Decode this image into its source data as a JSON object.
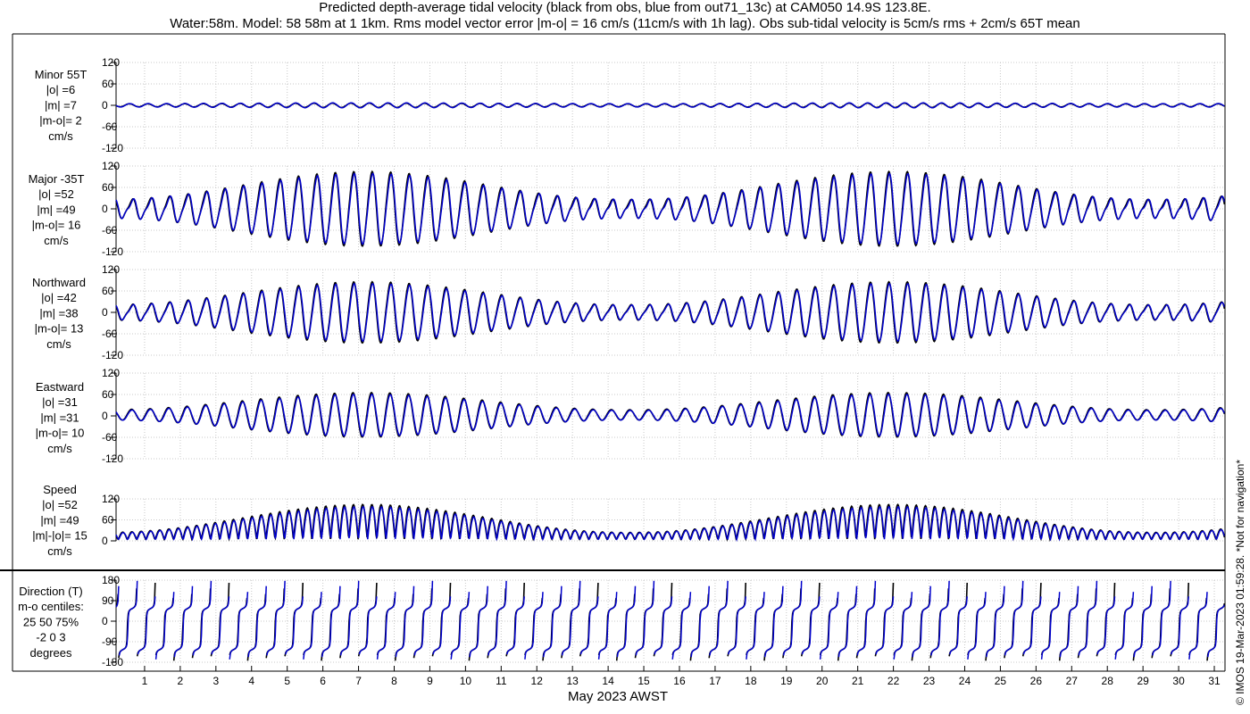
{
  "title_line1": "Predicted depth-average tidal velocity (black from obs, blue from out71_13c) at CAM050 14.9S 123.8E.",
  "title_line2": "Water:58m. Model: 58 58m at 1 1km. Rms model vector error |m-o| = 16 cm/s (11cm/s with 1h lag). Obs sub-tidal velocity is 5cm/s rms + 2cm/s 65T mean",
  "credit": "© IMOS 19-Mar-2023 01:59:28. *Not for navigation*",
  "xlabel": "May 2023 AWST",
  "colors": {
    "obs": "#000000",
    "model": "#0000cc",
    "grid": "#c8c8c8",
    "axis": "#000000"
  },
  "chart_data": {
    "type": "line",
    "x_axis": {
      "label": "May 2023 AWST",
      "unit": "day of May 2023",
      "range": [
        0.2,
        31.3
      ],
      "ticks": [
        1,
        2,
        3,
        4,
        5,
        6,
        7,
        8,
        9,
        10,
        11,
        12,
        13,
        14,
        15,
        16,
        17,
        18,
        19,
        20,
        21,
        22,
        23,
        24,
        25,
        26,
        27,
        28,
        29,
        30,
        31
      ]
    },
    "series_legend": {
      "obs": "black from obs",
      "model": "blue from out71_13c"
    },
    "panels": [
      {
        "key": "minor",
        "label_lines": [
          "Minor 55T",
          "|o| =6",
          "|m| =7",
          "|m-o|= 2",
          "cm/s"
        ],
        "ylim": [
          -120,
          120
        ],
        "yticks": [
          -120,
          -60,
          0,
          60,
          120
        ],
        "tick_labels": [
          "-120",
          "-60",
          "0",
          "60",
          "120"
        ],
        "obs_amplitude": 6,
        "model_amplitude": 7,
        "rms_diff": 2
      },
      {
        "key": "major",
        "label_lines": [
          "Major -35T",
          "|o| =52",
          "|m| =49",
          "|m-o|= 16",
          "cm/s"
        ],
        "ylim": [
          -120,
          120
        ],
        "yticks": [
          -120,
          -60,
          0,
          60,
          120
        ],
        "tick_labels": [
          "-120",
          "-60",
          "0",
          "60",
          "120"
        ],
        "obs_amplitude": 52,
        "model_amplitude": 49,
        "rms_diff": 16
      },
      {
        "key": "north",
        "label_lines": [
          "Northward",
          "|o| =42",
          "|m| =38",
          "|m-o|= 13",
          "cm/s"
        ],
        "ylim": [
          -120,
          120
        ],
        "yticks": [
          -120,
          -60,
          0,
          60,
          120
        ],
        "tick_labels": [
          "-120",
          "-60",
          "0",
          "60",
          "120"
        ],
        "obs_amplitude": 42,
        "model_amplitude": 38,
        "rms_diff": 13
      },
      {
        "key": "east",
        "label_lines": [
          "Eastward",
          "|o| =31",
          "|m| =31",
          "|m-o|= 10",
          "cm/s"
        ],
        "ylim": [
          -120,
          120
        ],
        "yticks": [
          -120,
          -60,
          0,
          60,
          120
        ],
        "tick_labels": [
          "-120",
          "-60",
          "0",
          "60",
          "120"
        ],
        "obs_amplitude": 31,
        "model_amplitude": 31,
        "rms_diff": 10
      },
      {
        "key": "speed",
        "label_lines": [
          "Speed",
          "|o| =52",
          "|m| =49",
          "|m|-|o|= 15",
          "cm/s"
        ],
        "ylim": [
          0,
          120
        ],
        "yticks": [
          0,
          60,
          120
        ],
        "tick_labels": [
          "0",
          "60",
          "120"
        ],
        "obs_amplitude": 52,
        "model_amplitude": 49,
        "rms_diff": 15
      },
      {
        "key": "direction",
        "label_lines": [
          "Direction (T)",
          "m-o centiles:",
          "25  50  75%",
          "-2  0  3",
          "degrees"
        ],
        "ylim": [
          -180,
          180
        ],
        "yticks": [
          -180,
          -90,
          0,
          90,
          180
        ],
        "tick_labels": [
          "-180",
          "-90",
          "0",
          "90",
          "180"
        ],
        "centiles": {
          "p25": -2,
          "p50": 0,
          "p75": 3
        }
      }
    ],
    "tidal_model": {
      "semidiurnal_period_days": 0.5175,
      "spring_neap_period_days": 14.77,
      "spring_peak_days": [
        7.2,
        19.9
      ],
      "major_peak_obs": [
        110,
        102
      ],
      "major_neap_min": [
        28,
        20
      ],
      "major_end_min": 18
    }
  }
}
